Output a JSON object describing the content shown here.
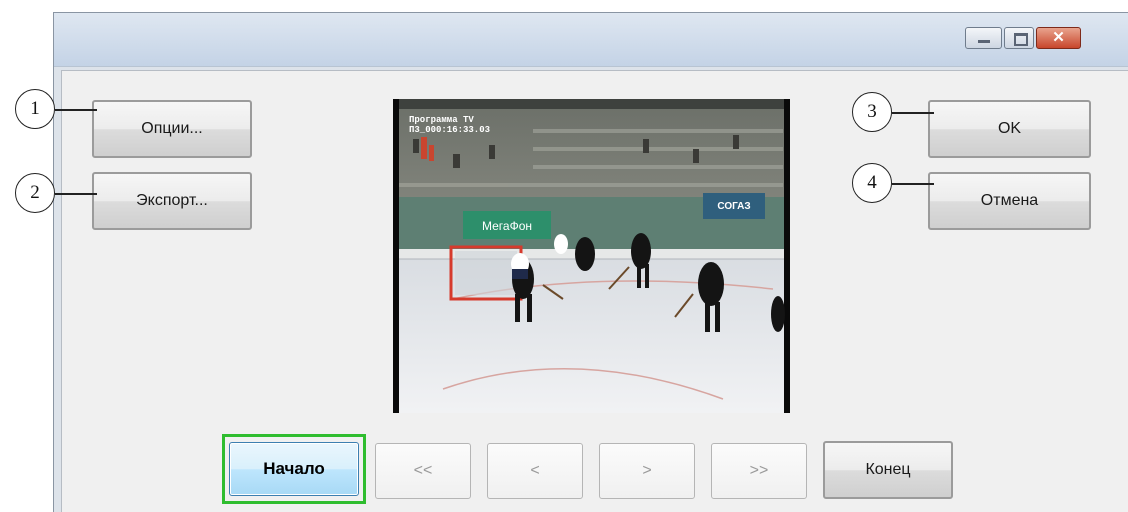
{
  "window": {
    "controls": {
      "minimize_icon": "minimize-icon",
      "maximize_icon": "maximize-icon",
      "close_icon": "close-icon",
      "close_symbol": "✕"
    }
  },
  "left_buttons": {
    "options": "Опции...",
    "export": "Экспорт..."
  },
  "right_buttons": {
    "ok": "OK",
    "cancel": "Отмена"
  },
  "callouts": [
    "1",
    "2",
    "3",
    "4"
  ],
  "video": {
    "overlay_line1": "Программа TV",
    "overlay_line2": "П3_000:16:33.03",
    "banner_left": "МегаФон",
    "banner_right": "СОГАЗ"
  },
  "navigation": {
    "start": "Начало",
    "first": "<<",
    "prev": "<",
    "next": ">",
    "last": ">>",
    "end": "Конец"
  },
  "colors": {
    "highlight": "#2fbd2f",
    "close_button": "#c8462c",
    "selected_button": "#bee6fd"
  }
}
